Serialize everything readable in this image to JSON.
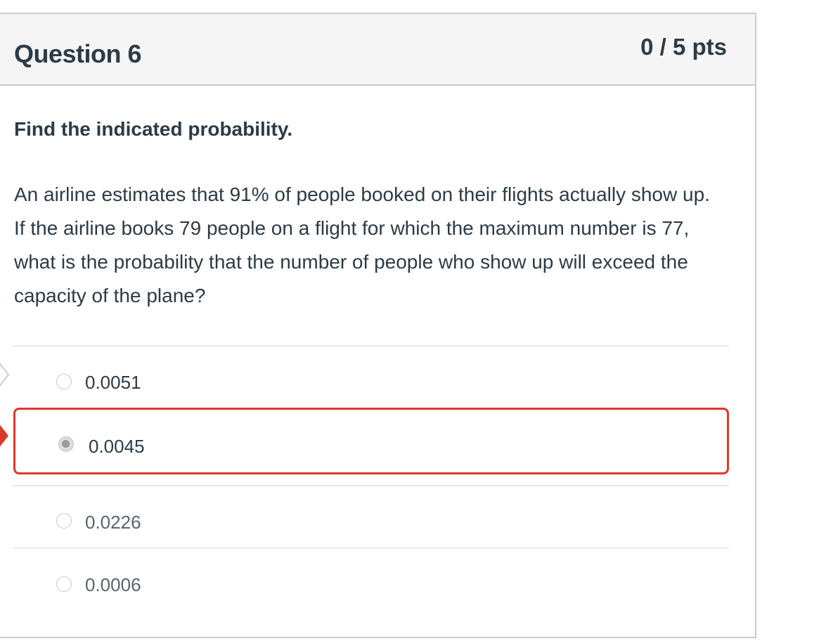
{
  "question": {
    "title": "Question 6",
    "points": "0 / 5 pts",
    "instruction": "Find the indicated probability.",
    "text": "An airline estimates that 91% of people booked on their flights actually show up. If the airline books 79 people on a flight for which the maximum number is 77, what is the probability that the number of people who show up will exceed the capacity of the plane?"
  },
  "answers": [
    {
      "label": "0.0051",
      "selected": false
    },
    {
      "label": "0.0045",
      "selected": true
    },
    {
      "label": "0.0226",
      "selected": false
    },
    {
      "label": "0.0006",
      "selected": false
    }
  ],
  "colors": {
    "selected_border": "#e0382a",
    "incorrect_marker": "#d73a2a",
    "header_bg": "#f5f5f5",
    "text": "#2d3b45"
  },
  "icons": {
    "correct_answer_marker": "outline-arrow-icon",
    "your_answer_marker": "red-arrow-icon"
  }
}
